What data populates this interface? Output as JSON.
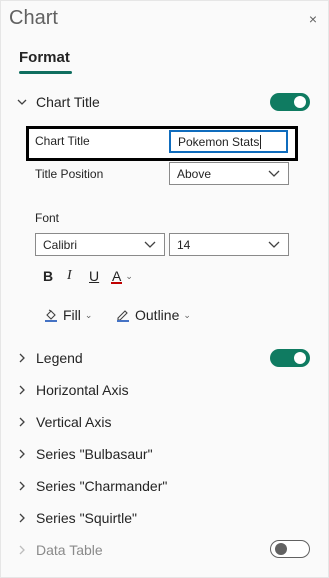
{
  "pane": {
    "title": "Chart",
    "close": "×"
  },
  "tabs": [
    {
      "label": "Format"
    }
  ],
  "chart_title_section": {
    "label": "Chart Title",
    "toggle": "on",
    "field_label": "Chart Title",
    "field_value": "Pokemon Stats",
    "position_label": "Title Position",
    "position_value": "Above"
  },
  "font": {
    "label": "Font",
    "family": "Calibri",
    "size": "14",
    "bold": "B",
    "italic": "I",
    "underline": "U",
    "color": "A",
    "fill_label": "Fill",
    "outline_label": "Outline"
  },
  "sections": [
    {
      "label": "Legend",
      "toggle": "on"
    },
    {
      "label": "Horizontal Axis"
    },
    {
      "label": "Vertical Axis"
    },
    {
      "label": "Series \"Bulbasaur\""
    },
    {
      "label": "Series \"Charmander\""
    },
    {
      "label": "Series \"Squirtle\""
    },
    {
      "label": "Data Table",
      "toggle": "off",
      "disabled": true
    }
  ],
  "colors": {
    "accent": "#0f7b61",
    "focus": "#0f6cbd",
    "font_color_bar": "#c00000"
  }
}
